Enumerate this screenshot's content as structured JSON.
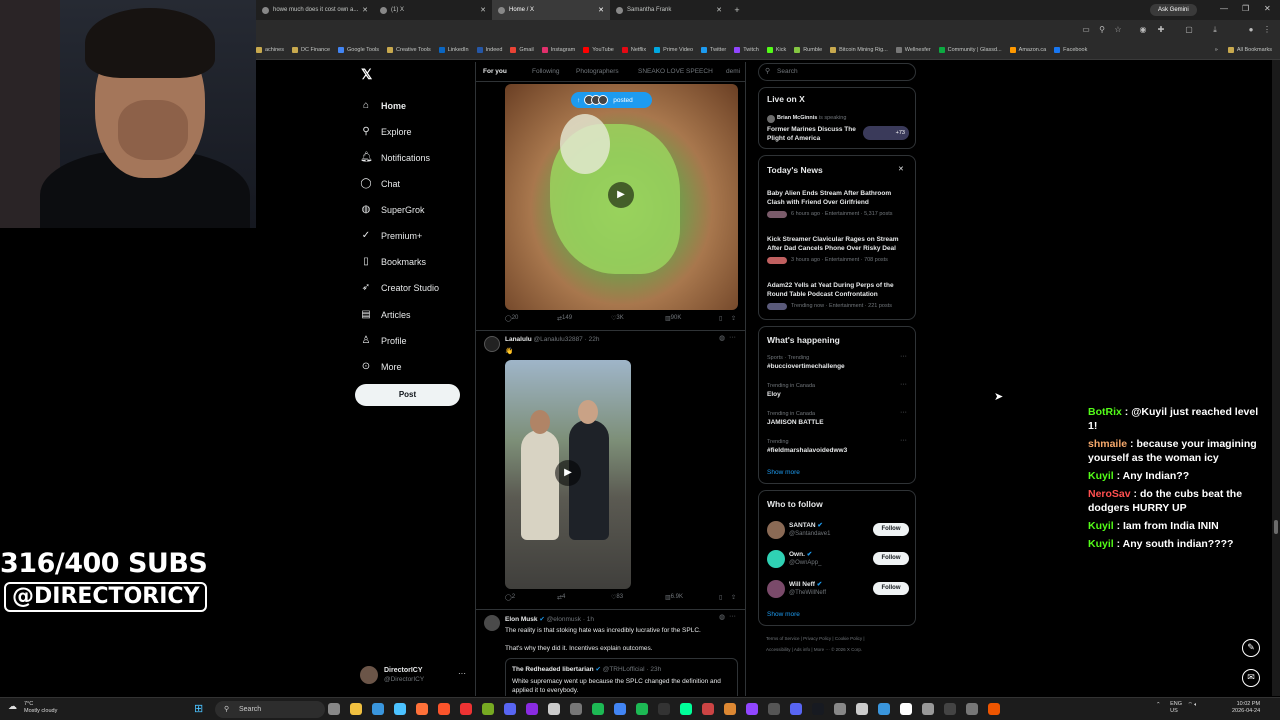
{
  "browser": {
    "tabs": [
      {
        "title": "howe much does it cost own a...",
        "close": "✕"
      },
      {
        "title": "(1) X",
        "close": "✕"
      },
      {
        "title": "Home / X",
        "close": "✕"
      },
      {
        "title": "Samantha Frank",
        "close": "✕"
      }
    ],
    "new_tab": "+",
    "gemini": "Ask Gemini",
    "window_controls": {
      "minimize": "—",
      "maximize": "❐",
      "close": "✕"
    },
    "bookmarks": [
      "achines",
      "DC Finance",
      "Google Tools",
      "Creative Tools",
      "LinkedIn",
      "Indeed",
      "Gmail",
      "Instagram",
      "YouTube",
      "Netflix",
      "Prime Video",
      "Twitter",
      "Twitch",
      "Kick",
      "Rumble",
      "Bitcoin Mining Rig...",
      "Wellnesfer",
      "Community | Glassd...",
      "Amazon.ca",
      "Facebook"
    ],
    "all_bookmarks": "All Bookmarks",
    "more_bookmarks": "»"
  },
  "stream_overlay": {
    "subs": "316/400 SUBS",
    "handle": "@DIRECTORICY"
  },
  "nav": {
    "logo": "𝕏",
    "items": [
      {
        "label": "Home",
        "icon": "home-icon",
        "glyph": "⌂"
      },
      {
        "label": "Explore",
        "icon": "search-icon",
        "glyph": "⚲"
      },
      {
        "label": "Notifications",
        "icon": "bell-icon",
        "glyph": "🔔︎"
      },
      {
        "label": "Chat",
        "icon": "chat-icon",
        "glyph": "◯"
      },
      {
        "label": "SuperGrok",
        "icon": "grok-icon",
        "glyph": "◍"
      },
      {
        "label": "Premium+",
        "icon": "premium-icon",
        "glyph": "✓"
      },
      {
        "label": "Bookmarks",
        "icon": "bookmark-icon",
        "glyph": "▯"
      },
      {
        "label": "Creator Studio",
        "icon": "rocket-icon",
        "glyph": "➶"
      },
      {
        "label": "Articles",
        "icon": "article-icon",
        "glyph": "▤"
      },
      {
        "label": "Profile",
        "icon": "person-icon",
        "glyph": "♙"
      },
      {
        "label": "More",
        "icon": "more-icon",
        "glyph": "⊙"
      }
    ],
    "post_button": "Post",
    "account": {
      "name": "DirectorICY",
      "handle": "@DirectorICY",
      "menu": "···"
    }
  },
  "timeline": {
    "tabs": [
      "For you",
      "Following",
      "Photographers",
      "SNEAKO LOVE SPEECH",
      "demi"
    ],
    "posted_pill": "posted",
    "posted_arrow": "↑",
    "tweet1_actions": {
      "replies": "20",
      "retweets": "149",
      "likes": "3K",
      "views": "90K"
    },
    "tweet2": {
      "name": "Lanalulu",
      "handle": "@Lanalulu32887",
      "time": "· 22h",
      "text": "👋",
      "menu": "···"
    },
    "tweet2_actions": {
      "replies": "2",
      "retweets": "4",
      "likes": "83",
      "views": "6.9K"
    },
    "tweet3": {
      "name": "Elon Musk",
      "handle": "@elonmusk",
      "time": "· 1h",
      "menu": "···",
      "text1": "The reality is that stoking hate was incredibly lucrative for the SPLC.",
      "text2": "That's why they did it. Incentives explain outcomes.",
      "quote_name": "The Redheaded libertarian",
      "quote_handle": "@TRHLofficial",
      "quote_time": "· 23h",
      "quote_text": "White supremacy went up because the SPLC changed the definition and applied it to everybody."
    }
  },
  "sidebar": {
    "search_placeholder": "Search",
    "live": {
      "title": "Live on X",
      "host": "Brian McGinnis",
      "status": "is speaking",
      "topic": "Former Marines Discuss The Plight of America",
      "count": "+73"
    },
    "news": {
      "title": "Today's News",
      "close": "✕",
      "items": [
        {
          "headline": "Baby Alien Ends Stream After Bathroom Clash with Friend Over Girlfriend",
          "meta": "6 hours ago · Entertainment · 5,317 posts"
        },
        {
          "headline": "Kick Streamer Clavicular Rages on Stream After Dad Cancels Phone Over Risky Deal",
          "meta": "3 hours ago · Entertainment · 708 posts"
        },
        {
          "headline": "Adam22 Yells at Yeat During Perps of the Round Table Podcast Confrontation",
          "meta": "Trending now · Entertainment · 221 posts"
        }
      ]
    },
    "happening": {
      "title": "What's happening",
      "items": [
        {
          "context": "Sports · Trending",
          "topic": "#bucciovertimechallenge"
        },
        {
          "context": "Trending in Canada",
          "topic": "Eloy"
        },
        {
          "context": "Trending in Canada",
          "topic": "JAMISON BATTLE"
        },
        {
          "context": "Trending",
          "topic": "#fieldmarshalavoidedww3"
        }
      ],
      "show_more": "Show more"
    },
    "follow": {
      "title": "Who to follow",
      "users": [
        {
          "name": "SANTAN",
          "handle": "@Santandave1",
          "button": "Follow"
        },
        {
          "name": "Own.",
          "handle": "@OwnApp_",
          "button": "Follow"
        },
        {
          "name": "Will Neff",
          "handle": "@TheWillNeff",
          "button": "Follow"
        }
      ],
      "show_more": "Show more"
    },
    "footer1": "Terms of Service  |  Privacy Policy  |  Cookie Policy  |",
    "footer2": "Accessibility  |  Ads info  |  More ···  © 2026 X Corp."
  },
  "chat": [
    {
      "user": "BotRix",
      "sep": " : ",
      "text": "@Kuyil just reached level 1!",
      "color": "#53fc18"
    },
    {
      "user": "shmaile",
      "sep": " : ",
      "text": "because your imagining yourself as the woman icy",
      "color": "#f5a86b"
    },
    {
      "user": "Kuyil",
      "sep": " : ",
      "text": "Any Indian??",
      "color": "#53fc18"
    },
    {
      "user": "NeroSav",
      "sep": " : ",
      "text": "do the cubs beat the dodgers HURRY UP",
      "color": "#ff4f4f"
    },
    {
      "user": "Kuyil",
      "sep": " : ",
      "text": "Iam from India ININ",
      "color": "#53fc18"
    },
    {
      "user": "Kuyil",
      "sep": " : ",
      "text": "Any south indian????",
      "color": "#53fc18"
    }
  ],
  "taskbar": {
    "weather_temp": "7°C",
    "weather_desc": "Mostly cloudy",
    "search": "Search",
    "lang1": "ENG",
    "lang2": "US",
    "time": "10:02 PM",
    "date": "2026-04-24"
  }
}
